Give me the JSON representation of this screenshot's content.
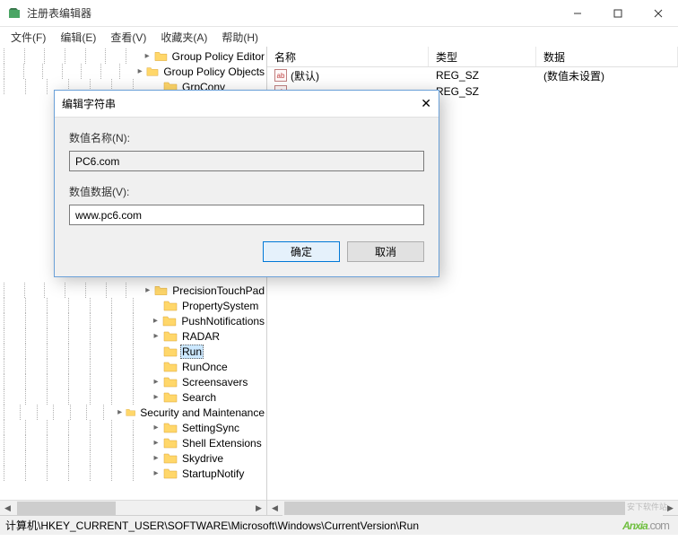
{
  "window": {
    "title": "注册表编辑器",
    "min_tip": "最小化",
    "max_tip": "最大化",
    "close_tip": "关闭"
  },
  "menu": {
    "file": "文件(F)",
    "edit": "编辑(E)",
    "view": "查看(V)",
    "fav": "收藏夹(A)",
    "help": "帮助(H)"
  },
  "tree": {
    "items": [
      {
        "label": "Group Policy Editor",
        "exp": "▸",
        "indent": 7
      },
      {
        "label": "Group Policy Objects",
        "exp": "▸",
        "indent": 7
      },
      {
        "label": "GrpConv",
        "exp": "",
        "indent": 7
      },
      {
        "label": "PrecisionTouchPad",
        "exp": "▸",
        "indent": 7
      },
      {
        "label": "PropertySystem",
        "exp": "",
        "indent": 7
      },
      {
        "label": "PushNotifications",
        "exp": "▸",
        "indent": 7
      },
      {
        "label": "RADAR",
        "exp": "▸",
        "indent": 7
      },
      {
        "label": "Run",
        "exp": "",
        "indent": 7,
        "selected": true
      },
      {
        "label": "RunOnce",
        "exp": "",
        "indent": 7
      },
      {
        "label": "Screensavers",
        "exp": "▸",
        "indent": 7
      },
      {
        "label": "Search",
        "exp": "▸",
        "indent": 7
      },
      {
        "label": "Security and Maintenance",
        "exp": "▸",
        "indent": 7
      },
      {
        "label": "SettingSync",
        "exp": "▸",
        "indent": 7
      },
      {
        "label": "Shell Extensions",
        "exp": "▸",
        "indent": 7
      },
      {
        "label": "Skydrive",
        "exp": "▸",
        "indent": 7
      },
      {
        "label": "StartupNotify",
        "exp": "▸",
        "indent": 7
      }
    ]
  },
  "list": {
    "cols": {
      "name": "名称",
      "type": "类型",
      "data": "数据"
    },
    "rows": [
      {
        "name": "(默认)",
        "type": "REG_SZ",
        "data": "(数值未设置)"
      },
      {
        "name": "",
        "type": "REG_SZ",
        "data": ""
      }
    ]
  },
  "dialog": {
    "title": "编辑字符串",
    "name_label": "数值名称(N):",
    "name_value": "PC6.com",
    "data_label": "数值数据(V):",
    "data_value": "www.pc6.com",
    "ok": "确定",
    "cancel": "取消"
  },
  "statusbar": {
    "path": "计算机\\HKEY_CURRENT_USER\\SOFTWARE\\Microsoft\\Windows\\CurrentVersion\\Run"
  },
  "watermark": {
    "brand": "Anxia",
    "suffix": ".com",
    "sub": "安下软件站"
  }
}
